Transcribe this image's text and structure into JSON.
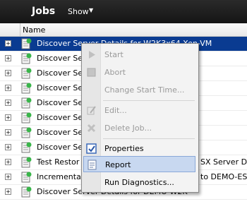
{
  "header": {
    "title": "Jobs",
    "show_label": "Show",
    "caret": "▼"
  },
  "column": {
    "name": "Name"
  },
  "rows": [
    {
      "label": "Discover Server Details for W2K3x64-Xen-VM",
      "selected": true
    },
    {
      "label": "Discover Se"
    },
    {
      "label": "Discover Se"
    },
    {
      "label": "Discover Se"
    },
    {
      "label": "Discover Se"
    },
    {
      "label": "Discover Se"
    },
    {
      "label": "Discover Se"
    },
    {
      "label": "Discover Se"
    },
    {
      "label": "Test Restor",
      "suffix": "SX Server D"
    },
    {
      "label": "Incremental",
      "suffix": "to DEMO-ES"
    },
    {
      "label": "Discover Server Details for DEMO-W2K"
    }
  ],
  "menu": {
    "items": [
      {
        "label": "Start",
        "disabled": true,
        "icon": "play-icon"
      },
      {
        "label": "Abort",
        "disabled": true,
        "icon": "stop-icon"
      },
      {
        "label": "Change Start Time...",
        "disabled": true,
        "icon": ""
      },
      {
        "label": "Edit...",
        "disabled": true,
        "icon": "edit-icon"
      },
      {
        "label": "Delete Job...",
        "disabled": true,
        "icon": "delete-icon"
      },
      {
        "label": "Properties",
        "disabled": false,
        "icon": "properties-icon"
      },
      {
        "label": "Report",
        "disabled": false,
        "icon": "report-icon",
        "highlighted": true
      },
      {
        "label": "Run Diagnostics...",
        "disabled": false,
        "icon": ""
      }
    ]
  },
  "colors": {
    "selection": "#0a3b91",
    "menu_highlight": "#c8d8f0",
    "header": "#1a1a1a"
  }
}
